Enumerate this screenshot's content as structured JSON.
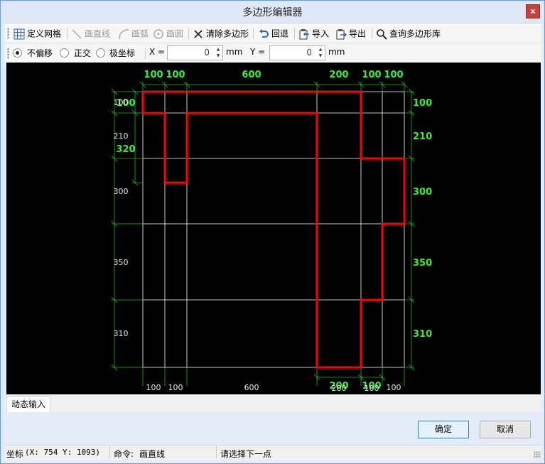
{
  "window": {
    "title": "多边形编辑器",
    "close_label": "x"
  },
  "toolbar": {
    "define_grid": "定义网格",
    "draw_line": "画直线",
    "draw_arc": "画弧",
    "draw_circle": "画圆",
    "clear_polygon": "清除多边形",
    "undo": "回退",
    "import": "导入",
    "export": "导出",
    "query_library": "查询多边形库"
  },
  "options": {
    "no_offset": "不偏移",
    "orthogonal": "正交",
    "polar": "极坐标",
    "selected": "no_offset",
    "x_label": "X =",
    "x_value": "0",
    "y_label": "Y =",
    "y_value": "0",
    "unit": "mm"
  },
  "grid": {
    "top_dims": [
      "100",
      "100",
      "600",
      "200",
      "100",
      "100"
    ],
    "bottom_grid_dims": [
      "100",
      "100",
      "600",
      "200",
      "100",
      "100"
    ],
    "bottom_poly_dims": [
      "200",
      "100"
    ],
    "left_grid_dims": [
      "100",
      "210",
      "300",
      "350",
      "310"
    ],
    "left_poly_dims": [
      "100",
      "320"
    ],
    "right_dims": [
      "100",
      "210",
      "300",
      "350",
      "310"
    ],
    "grid_color": "#ffffff",
    "dim_color": "#2ee82e",
    "polygon_color": "#ff0000"
  },
  "tabs": {
    "dynamic_input": "动态输入"
  },
  "buttons": {
    "ok": "确定",
    "cancel": "取消"
  },
  "status": {
    "coord_label": "坐标",
    "coord_value": "(X: 754 Y: 1093)",
    "command_label": "命令:",
    "command_value": "画直线",
    "prompt": "请选择下一点"
  }
}
